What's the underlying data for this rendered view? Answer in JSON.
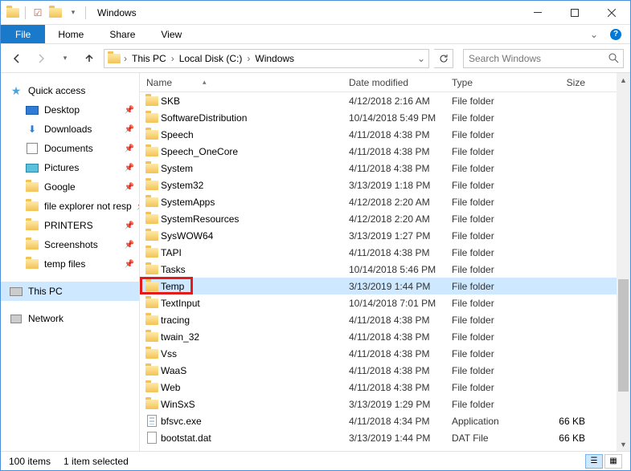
{
  "window": {
    "title": "Windows"
  },
  "ribbon": {
    "file": "File",
    "tabs": [
      "Home",
      "Share",
      "View"
    ]
  },
  "breadcrumb": {
    "segments": [
      "This PC",
      "Local Disk (C:)",
      "Windows"
    ]
  },
  "search": {
    "placeholder": "Search Windows"
  },
  "sidebar": {
    "quick_access": "Quick access",
    "pinned": [
      {
        "label": "Desktop",
        "icon": "desktop"
      },
      {
        "label": "Downloads",
        "icon": "downloads"
      },
      {
        "label": "Documents",
        "icon": "documents"
      },
      {
        "label": "Pictures",
        "icon": "pictures"
      },
      {
        "label": "Google",
        "icon": "folder"
      },
      {
        "label": "file explorer not resp",
        "icon": "folder"
      },
      {
        "label": "PRINTERS",
        "icon": "folder"
      },
      {
        "label": "Screenshots",
        "icon": "folder"
      },
      {
        "label": "temp files",
        "icon": "folder"
      }
    ],
    "this_pc": "This PC",
    "network": "Network"
  },
  "columns": {
    "name": "Name",
    "date": "Date modified",
    "type": "Type",
    "size": "Size"
  },
  "files": [
    {
      "name": "SKB",
      "date": "4/12/2018 2:16 AM",
      "type": "File folder",
      "size": "",
      "icon": "folder"
    },
    {
      "name": "SoftwareDistribution",
      "date": "10/14/2018 5:49 PM",
      "type": "File folder",
      "size": "",
      "icon": "folder"
    },
    {
      "name": "Speech",
      "date": "4/11/2018 4:38 PM",
      "type": "File folder",
      "size": "",
      "icon": "folder"
    },
    {
      "name": "Speech_OneCore",
      "date": "4/11/2018 4:38 PM",
      "type": "File folder",
      "size": "",
      "icon": "folder"
    },
    {
      "name": "System",
      "date": "4/11/2018 4:38 PM",
      "type": "File folder",
      "size": "",
      "icon": "folder"
    },
    {
      "name": "System32",
      "date": "3/13/2019 1:18 PM",
      "type": "File folder",
      "size": "",
      "icon": "folder"
    },
    {
      "name": "SystemApps",
      "date": "4/12/2018 2:20 AM",
      "type": "File folder",
      "size": "",
      "icon": "folder"
    },
    {
      "name": "SystemResources",
      "date": "4/12/2018 2:20 AM",
      "type": "File folder",
      "size": "",
      "icon": "folder"
    },
    {
      "name": "SysWOW64",
      "date": "3/13/2019 1:27 PM",
      "type": "File folder",
      "size": "",
      "icon": "folder"
    },
    {
      "name": "TAPI",
      "date": "4/11/2018 4:38 PM",
      "type": "File folder",
      "size": "",
      "icon": "folder"
    },
    {
      "name": "Tasks",
      "date": "10/14/2018 5:46 PM",
      "type": "File folder",
      "size": "",
      "icon": "folder"
    },
    {
      "name": "Temp",
      "date": "3/13/2019 1:44 PM",
      "type": "File folder",
      "size": "",
      "icon": "folder",
      "selected": true,
      "highlight": true
    },
    {
      "name": "TextInput",
      "date": "10/14/2018 7:01 PM",
      "type": "File folder",
      "size": "",
      "icon": "folder"
    },
    {
      "name": "tracing",
      "date": "4/11/2018 4:38 PM",
      "type": "File folder",
      "size": "",
      "icon": "folder"
    },
    {
      "name": "twain_32",
      "date": "4/11/2018 4:38 PM",
      "type": "File folder",
      "size": "",
      "icon": "folder"
    },
    {
      "name": "Vss",
      "date": "4/11/2018 4:38 PM",
      "type": "File folder",
      "size": "",
      "icon": "folder"
    },
    {
      "name": "WaaS",
      "date": "4/11/2018 4:38 PM",
      "type": "File folder",
      "size": "",
      "icon": "folder"
    },
    {
      "name": "Web",
      "date": "4/11/2018 4:38 PM",
      "type": "File folder",
      "size": "",
      "icon": "folder"
    },
    {
      "name": "WinSxS",
      "date": "3/13/2019 1:29 PM",
      "type": "File folder",
      "size": "",
      "icon": "folder"
    },
    {
      "name": "bfsvc.exe",
      "date": "4/11/2018 4:34 PM",
      "type": "Application",
      "size": "66 KB",
      "icon": "app"
    },
    {
      "name": "bootstat.dat",
      "date": "3/13/2019 1:44 PM",
      "type": "DAT File",
      "size": "66 KB",
      "icon": "file"
    }
  ],
  "status": {
    "count": "100 items",
    "selected": "1 item selected"
  }
}
